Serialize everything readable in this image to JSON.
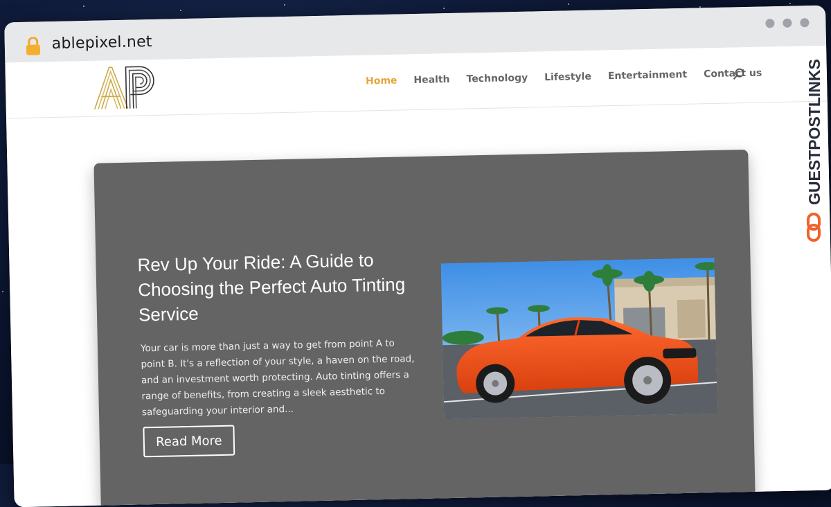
{
  "browser": {
    "url": "ablepixel.net"
  },
  "site": {
    "logo_alt": "AP",
    "nav": [
      {
        "label": "Home",
        "active": true
      },
      {
        "label": "Health",
        "active": false
      },
      {
        "label": "Technology",
        "active": false
      },
      {
        "label": "Lifestyle",
        "active": false
      },
      {
        "label": "Entertainment",
        "active": false
      },
      {
        "label": "Contact us",
        "active": false
      }
    ]
  },
  "hero": {
    "title": "Rev Up Your Ride: A Guide to Choosing the Perfect Auto Tinting Service",
    "excerpt": "Your car is more than just a way to get from point A to point B. It's a reflection of your style, a haven on the road, and an investment worth protecting. Auto tinting offers a range of benefits, from creating a sleek aesthetic to safeguarding your interior and...",
    "button_label": "Read More"
  },
  "overlay": {
    "brand_text": "GUESTPOSTLINKS"
  },
  "colors": {
    "nav_active": "#e9a53a",
    "hero_bg": "#646464",
    "brand_orange": "#f0622a",
    "brand_dark": "#2a2d3a"
  }
}
